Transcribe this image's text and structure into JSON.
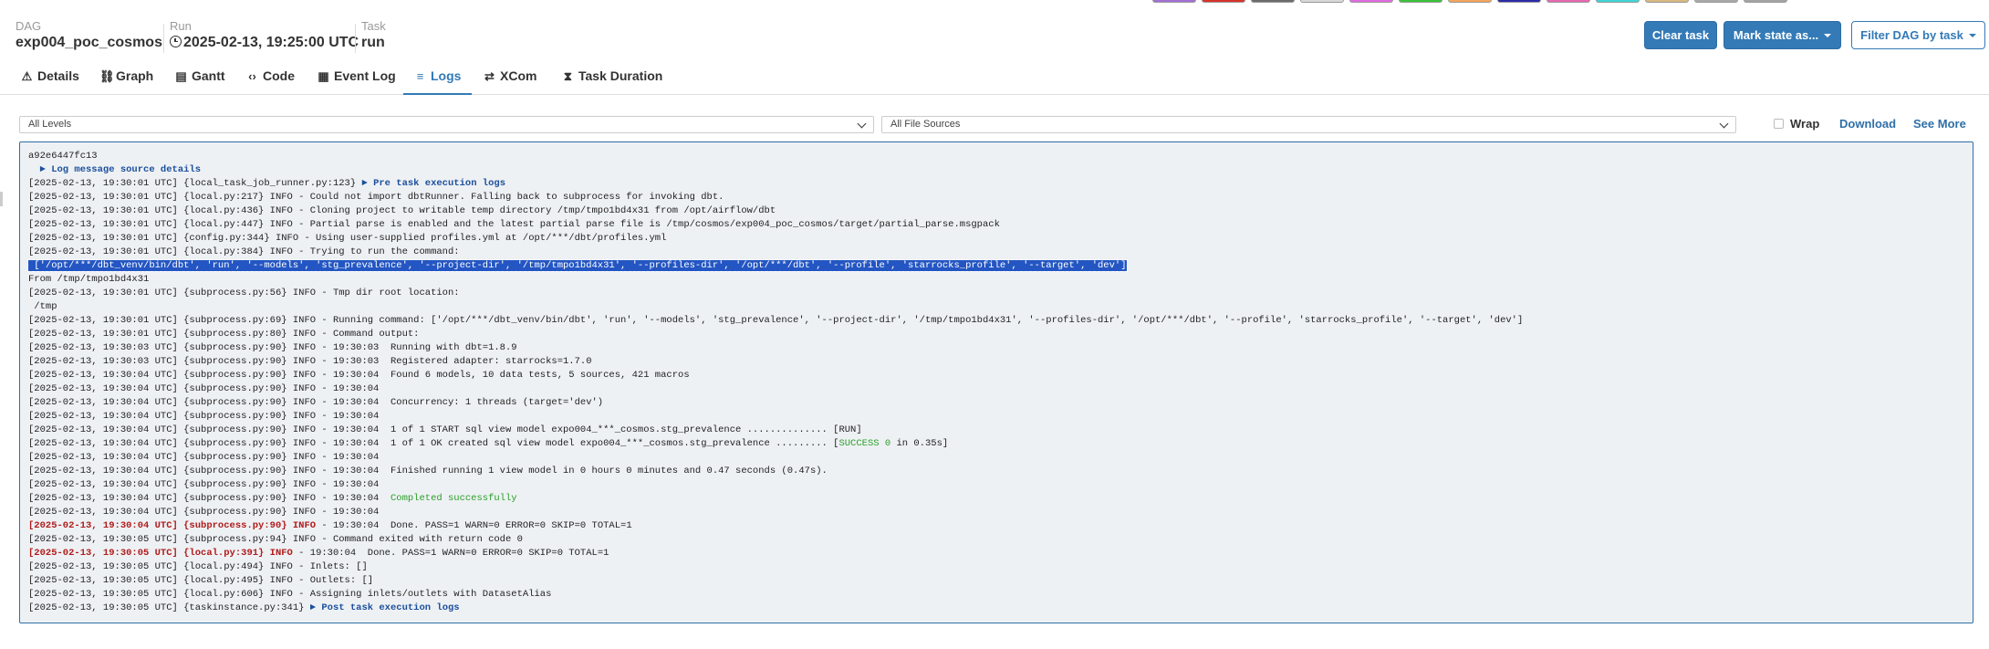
{
  "state_legend": [
    "#a270d4",
    "#d8322c",
    "#6c6c6c",
    "#d8d8d8",
    "#e06ae0",
    "#3ac23a",
    "#f2a65e",
    "#2c2ca8",
    "#e668b0",
    "#40d4d4",
    "#d8b880",
    "#a8a8a8",
    "#a4a4a4"
  ],
  "header": {
    "dag_label": "DAG",
    "dag_id": "exp004_poc_cosmos",
    "run_label": "Run",
    "run_value": "2025-02-13, 19:25:00 UTC",
    "task_label": "Task",
    "task_value": "run"
  },
  "actions": {
    "clear_task": "Clear task",
    "mark_state": "Mark state as...",
    "filter_dag": "Filter DAG by task"
  },
  "tabs": [
    {
      "label": "Details",
      "icon": "warning-icon"
    },
    {
      "label": "Graph",
      "icon": "graph-icon"
    },
    {
      "label": "Gantt",
      "icon": "gantt-icon"
    },
    {
      "label": "Code",
      "icon": "code-icon"
    },
    {
      "label": "Event Log",
      "icon": "event-log-icon"
    },
    {
      "label": "Logs",
      "icon": "logs-icon"
    },
    {
      "label": "XCom",
      "icon": "xcom-icon"
    },
    {
      "label": "Task Duration",
      "icon": "hourglass-icon"
    }
  ],
  "filters": {
    "levels": "All Levels",
    "sources": "All File Sources",
    "wrap": "Wrap",
    "download": "Download",
    "see_more": "See More"
  },
  "log": [
    {
      "text": "a92e6447fc13"
    },
    {
      "text": "  ► Log message source details",
      "link": true
    },
    {
      "text": "[2025-02-13, 19:30:01 UTC] {local_task_job_runner.py:123} ",
      "suffix": "► Pre task execution logs"
    },
    {
      "text": "[2025-02-13, 19:30:01 UTC] {local.py:217} INFO - Could not import dbtRunner. Falling back to subprocess for invoking dbt."
    },
    {
      "text": "[2025-02-13, 19:30:01 UTC] {local.py:436} INFO - Cloning project to writable temp directory /tmp/tmpo1bd4x31 from /opt/airflow/dbt"
    },
    {
      "text": "[2025-02-13, 19:30:01 UTC] {local.py:447} INFO - Partial parse is enabled and the latest partial parse file is /tmp/cosmos/exp004_poc_cosmos/target/partial_parse.msgpack"
    },
    {
      "text": "[2025-02-13, 19:30:01 UTC] {config.py:344} INFO - Using user-supplied profiles.yml at /opt/***/dbt/profiles.yml"
    },
    {
      "text": "[2025-02-13, 19:30:01 UTC] {local.py:384} INFO - Trying to run the command:"
    },
    {
      "text": " ['/opt/***/dbt_venv/bin/dbt', 'run', '--models', 'stg_prevalence', '--project-dir', '/tmp/tmpo1bd4x31', '--profiles-dir', '/opt/***/dbt', '--profile', 'starrocks_profile', '--target', 'dev']",
      "highlight": true
    },
    {
      "text": "From /tmp/tmpo1bd4x31"
    },
    {
      "text": "[2025-02-13, 19:30:01 UTC] {subprocess.py:56} INFO - Tmp dir root location:"
    },
    {
      "text": " /tmp"
    },
    {
      "text": "[2025-02-13, 19:30:01 UTC] {subprocess.py:69} INFO - Running command: ['/opt/***/dbt_venv/bin/dbt', 'run', '--models', 'stg_prevalence', '--project-dir', '/tmp/tmpo1bd4x31', '--profiles-dir', '/opt/***/dbt', '--profile', 'starrocks_profile', '--target', 'dev']"
    },
    {
      "text": "[2025-02-13, 19:30:01 UTC] {subprocess.py:80} INFO - Command output:"
    },
    {
      "text": "[2025-02-13, 19:30:03 UTC] {subprocess.py:90} INFO - 19:30:03  Running with dbt=1.8.9"
    },
    {
      "text": "[2025-02-13, 19:30:03 UTC] {subprocess.py:90} INFO - 19:30:03  Registered adapter: starrocks=1.7.0"
    },
    {
      "text": "[2025-02-13, 19:30:04 UTC] {subprocess.py:90} INFO - 19:30:04  Found 6 models, 10 data tests, 5 sources, 421 macros"
    },
    {
      "text": "[2025-02-13, 19:30:04 UTC] {subprocess.py:90} INFO - 19:30:04"
    },
    {
      "text": "[2025-02-13, 19:30:04 UTC] {subprocess.py:90} INFO - 19:30:04  Concurrency: 1 threads (target='dev')"
    },
    {
      "text": "[2025-02-13, 19:30:04 UTC] {subprocess.py:90} INFO - 19:30:04"
    },
    {
      "text": "[2025-02-13, 19:30:04 UTC] {subprocess.py:90} INFO - 19:30:04  1 of 1 START sql view model expo004_***_cosmos.stg_prevalence .............. [RUN]"
    },
    {
      "text": "[2025-02-13, 19:30:04 UTC] {subprocess.py:90} INFO - 19:30:04  1 of 1 OK created sql view model expo004_***_cosmos.stg_prevalence ......... [",
      "green": "SUCCESS 0",
      "after": " in 0.35s]"
    },
    {
      "text": "[2025-02-13, 19:30:04 UTC] {subprocess.py:90} INFO - 19:30:04"
    },
    {
      "text": "[2025-02-13, 19:30:04 UTC] {subprocess.py:90} INFO - 19:30:04  Finished running 1 view model in 0 hours 0 minutes and 0.47 seconds (0.47s)."
    },
    {
      "text": "[2025-02-13, 19:30:04 UTC] {subprocess.py:90} INFO - 19:30:04"
    },
    {
      "text": "[2025-02-13, 19:30:04 UTC] {subprocess.py:90} INFO - 19:30:04  ",
      "green": "Completed successfully",
      "after": ""
    },
    {
      "text": "[2025-02-13, 19:30:04 UTC] {subprocess.py:90} INFO - 19:30:04"
    },
    {
      "prefix": "[2025-02-13, 19:30:04 UTC] {subprocess.py:90} INFO",
      "text": " - 19:30:04  Done. PASS=1 WARN=0 ERROR=0 SKIP=0 TOTAL=1"
    },
    {
      "text": "[2025-02-13, 19:30:05 UTC] {subprocess.py:94} INFO - Command exited with return code 0"
    },
    {
      "prefix": "[2025-02-13, 19:30:05 UTC] {local.py:391} INFO",
      "text": " - 19:30:04  Done. PASS=1 WARN=0 ERROR=0 SKIP=0 TOTAL=1"
    },
    {
      "text": "[2025-02-13, 19:30:05 UTC] {local.py:494} INFO - Inlets: []"
    },
    {
      "text": "[2025-02-13, 19:30:05 UTC] {local.py:495} INFO - Outlets: []"
    },
    {
      "text": "[2025-02-13, 19:30:05 UTC] {local.py:606} INFO - Assigning inlets/outlets with DatasetAlias"
    },
    {
      "text": "[2025-02-13, 19:30:05 UTC] {taskinstance.py:341} ",
      "suffix": "► Post task execution logs"
    }
  ]
}
